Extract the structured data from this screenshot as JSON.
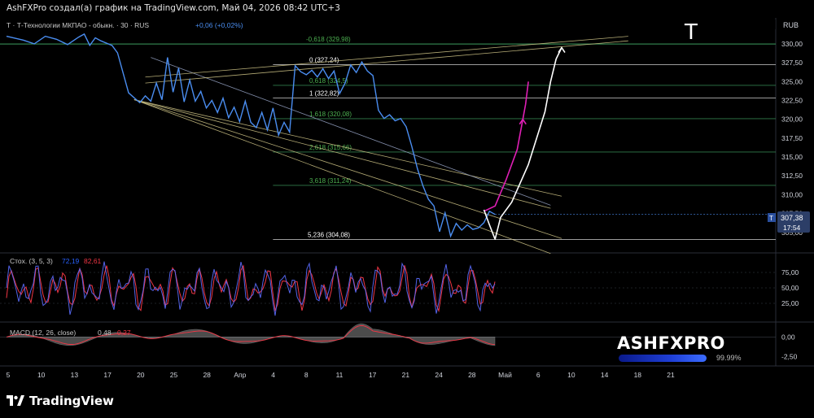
{
  "header": {
    "source_line": "AshFXPro создал(а) график на TradingView.com, Май 04, 2026 08:42 UTC+3"
  },
  "symbol": {
    "legend": "Т · Т-Технологии МКПАО - обыкн. · 30 · RUS",
    "legend_change": "+0,06 (+0,02%)",
    "ticker_badge": "T",
    "currency": "RUB",
    "last_price": "307,38",
    "countdown": "17:54",
    "price_color": "#4a8df0"
  },
  "chart_data": [
    {
      "type": "line",
      "name": "price-pane",
      "x_unit": "date (Mar–May 2026)",
      "y_axis": {
        "ticks": [
          305,
          307.5,
          310,
          312.5,
          315,
          317.5,
          320,
          322.5,
          325,
          327.5,
          330
        ],
        "tick_labels": [
          "305,00",
          "307,50",
          "310,00",
          "312,50",
          "315,00",
          "317,50",
          "320,00",
          "322,50",
          "325,00",
          "327,50",
          "330,00"
        ],
        "ylim": [
          302.5,
          331.5
        ]
      },
      "x_axis": {
        "tick_labels": [
          "5",
          "10",
          "13",
          "17",
          "20",
          "25",
          "28",
          "Апр",
          "4",
          "8",
          "11",
          "17",
          "21",
          "24",
          "28",
          "Май",
          "6",
          "10",
          "14",
          "18",
          "21"
        ]
      },
      "price": [
        [
          0,
          331
        ],
        [
          3,
          330.5
        ],
        [
          5,
          330
        ],
        [
          7,
          331
        ],
        [
          9,
          330.6
        ],
        [
          11,
          329.9
        ],
        [
          13,
          330.9
        ],
        [
          14,
          331.3
        ],
        [
          15,
          329.8
        ],
        [
          16,
          330.8
        ],
        [
          17,
          330.4
        ],
        [
          19,
          329.8
        ],
        [
          20,
          328.8
        ],
        [
          22,
          323.5
        ],
        [
          24,
          322.2
        ],
        [
          25,
          323.1
        ],
        [
          26,
          322.4
        ],
        [
          27,
          324.8
        ],
        [
          28,
          322.6
        ],
        [
          29,
          328.2
        ],
        [
          30,
          323.6
        ],
        [
          31,
          326.8
        ],
        [
          32,
          322.3
        ],
        [
          33,
          325.2
        ],
        [
          34,
          322.4
        ],
        [
          35,
          323.7
        ],
        [
          36,
          321.5
        ],
        [
          37,
          322.5
        ],
        [
          38,
          320.9
        ],
        [
          39,
          322.8
        ],
        [
          40,
          320.2
        ],
        [
          41,
          321.6
        ],
        [
          42,
          319.7
        ],
        [
          43,
          322.4
        ],
        [
          44,
          319.6
        ],
        [
          45,
          318.9
        ],
        [
          46,
          320.9
        ],
        [
          47,
          318.6
        ],
        [
          48,
          321.5
        ],
        [
          49,
          317.9
        ],
        [
          50,
          319.6
        ],
        [
          51,
          318.3
        ],
        [
          52,
          327.1
        ],
        [
          53,
          326.3
        ],
        [
          54,
          325.9
        ],
        [
          55,
          326.5
        ],
        [
          56,
          325.6
        ],
        [
          57,
          326.7
        ],
        [
          58,
          325.4
        ],
        [
          59,
          326.4
        ],
        [
          60,
          323.4
        ],
        [
          61,
          324.8
        ],
        [
          62,
          327.2
        ],
        [
          63,
          326.2
        ],
        [
          64,
          327.6
        ],
        [
          65,
          326.4
        ],
        [
          66,
          325.8
        ],
        [
          67,
          321.2
        ],
        [
          68,
          320.1
        ],
        [
          69,
          320.6
        ],
        [
          70,
          319.8
        ],
        [
          71,
          320.1
        ],
        [
          72,
          319.0
        ],
        [
          73,
          316.4
        ],
        [
          74,
          313.5
        ],
        [
          75,
          311.2
        ],
        [
          76,
          309.4
        ],
        [
          77,
          308.5
        ],
        [
          78,
          305.1
        ],
        [
          79,
          307.6
        ],
        [
          80,
          304.5
        ],
        [
          81,
          306.2
        ],
        [
          82,
          305.3
        ],
        [
          83,
          306.0
        ],
        [
          84,
          305.4
        ],
        [
          85,
          305.6
        ],
        [
          86,
          306.3
        ],
        [
          87,
          307.8
        ],
        [
          88,
          307.38
        ]
      ],
      "fib_levels": [
        {
          "label": "-0,618 (329,98)",
          "value": 329.98,
          "color": "#4caf50"
        },
        {
          "label": "0 (327,24)",
          "value": 327.24,
          "color": "#ffffff"
        },
        {
          "label": "0,618 (324,5)",
          "value": 324.5,
          "color": "#4caf50"
        },
        {
          "label": "1 (322,82)",
          "value": 322.82,
          "color": "#ffffff"
        },
        {
          "label": "1,618 (320,08)",
          "value": 320.08,
          "color": "#4caf50"
        },
        {
          "label": "2,618 (315,66)",
          "value": 315.66,
          "color": "#4caf50"
        },
        {
          "label": "3,618 (311,24)",
          "value": 311.24,
          "color": "#4caf50"
        },
        {
          "label": "5,236 (304,08)",
          "value": 304.08,
          "color": "#ffffff"
        }
      ],
      "projection_magenta": [
        [
          86,
          307.8
        ],
        [
          88,
          308.5
        ],
        [
          90,
          312
        ],
        [
          92,
          316
        ],
        [
          93,
          320
        ],
        [
          93.5,
          322
        ],
        [
          94,
          325
        ]
      ],
      "projection_white": [
        [
          86,
          308
        ],
        [
          87,
          306
        ],
        [
          88,
          304.1
        ],
        [
          89,
          307
        ],
        [
          91,
          309
        ],
        [
          94,
          314
        ],
        [
          97,
          321
        ],
        [
          98,
          325
        ],
        [
          99,
          328
        ],
        [
          100,
          329.5
        ]
      ]
    },
    {
      "type": "line",
      "name": "stochastic",
      "legend": "Стох. (3, 5, 3)",
      "k_value": "72,19",
      "d_value": "82,61",
      "k_color": "#2962ff",
      "d_color": "#f23645",
      "y_axis": {
        "tick_labels": [
          "75,00",
          "50,00",
          "25,00"
        ],
        "ylim": [
          0,
          100
        ]
      }
    },
    {
      "type": "area",
      "name": "macd",
      "legend": "MACD (12, 26, close)",
      "macd_value": "0,48",
      "signal_value": "0,27",
      "signal_color": "#f23645",
      "y_axis": {
        "tick_labels": [
          "0,00",
          "-2,50"
        ],
        "ylim": [
          -3.5,
          1.5
        ]
      }
    }
  ],
  "brand": {
    "name": "ASHFXPRO",
    "percent": "99.99%"
  },
  "footer": {
    "logo_text": "TradingView"
  }
}
